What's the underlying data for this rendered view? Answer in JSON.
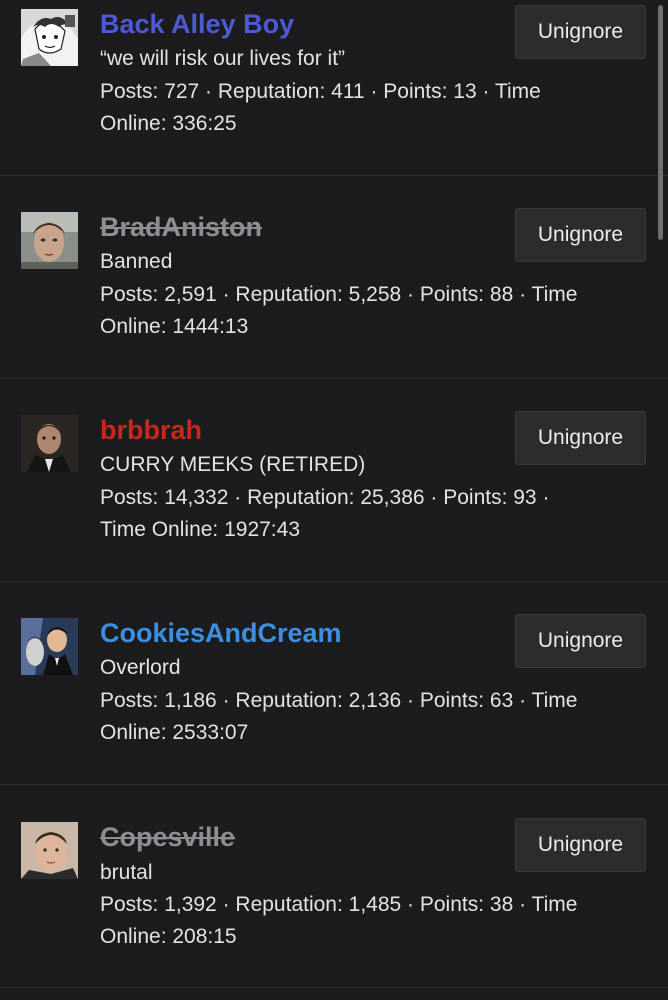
{
  "colors": {
    "background": "#1c1c1e",
    "button_background": "#2c2c2e",
    "banned_name": "#8e8e93"
  },
  "button_label": "Unignore",
  "users": [
    {
      "name": "Back Alley Boy",
      "name_color": "#4c5bd4",
      "banned": false,
      "title": "“we will risk our lives for it”",
      "stats_line1": "Posts: 727 · Reputation: 411 · Points: 13 · Time",
      "stats_line2": "Online: 336:25",
      "avatar_icon": "manga-avatar-icon"
    },
    {
      "name": "BradAniston",
      "name_color": "#8e8e93",
      "banned": true,
      "title": "Banned",
      "stats_line1": "Posts: 2,591 · Reputation: 5,258 · Points: 88 · Time",
      "stats_line2": "Online: 1444:13",
      "avatar_icon": "face-photo-avatar-icon"
    },
    {
      "name": "brbbrah",
      "name_color": "#c4291c",
      "banned": false,
      "title": "CURRY MEEKS (RETIRED)",
      "stats_line1": "Posts: 14,332 · Reputation: 25,386 · Points: 93 ·",
      "stats_line2": "Time Online: 1927:43",
      "avatar_icon": "suit-photo-avatar-icon"
    },
    {
      "name": "CookiesAndCream",
      "name_color": "#3d8fe0",
      "banned": false,
      "title": "Overlord",
      "stats_line1": "Posts: 1,186 · Reputation: 2,136 · Points: 63 · Time",
      "stats_line2": "Online: 2533:07",
      "avatar_icon": "comic-avatar-icon"
    },
    {
      "name": "Copesville",
      "name_color": "#8e8e93",
      "banned": true,
      "title": "brutal",
      "stats_line1": "Posts: 1,392 · Reputation: 1,485 · Points: 38 · Time",
      "stats_line2": "Online: 208:15",
      "avatar_icon": "selfie-avatar-icon"
    }
  ]
}
